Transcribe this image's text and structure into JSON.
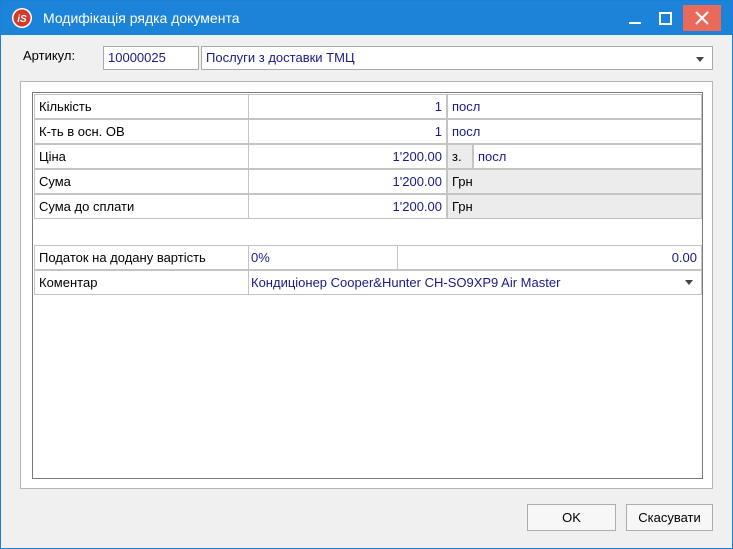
{
  "window": {
    "title": "Модифікація рядка документа",
    "accent": "#1c84d8",
    "close_color": "#e96a5b"
  },
  "header": {
    "article_label": "Артикул:",
    "article_code": "10000025",
    "article_name": "Послуги з доставки ТМЦ"
  },
  "rows": [
    {
      "label": "Кількість",
      "value": "1",
      "unit": "посл"
    },
    {
      "label": "К-ть в осн. ОВ",
      "value": "1",
      "unit": "посл"
    },
    {
      "label": "Ціна",
      "value": "1'200.00",
      "unit_prefix": "з.",
      "unit": "посл"
    },
    {
      "label": "Сума",
      "value": "1'200.00",
      "unit": "Грн"
    },
    {
      "label": "Сума до сплати",
      "value": "1'200.00",
      "unit": "Грн"
    }
  ],
  "vat": {
    "label": "Податок на додану вартість",
    "rate": "0%",
    "amount": "0.00"
  },
  "comment": {
    "label": "Коментар",
    "value": "Кондиціонер Cooper&Hunter CH-SO9XP9 Air Master"
  },
  "buttons": {
    "ok": "OK",
    "cancel": "Скасувати"
  },
  "icons": [
    "app-logo-icon",
    "minimize-icon",
    "maximize-icon",
    "close-icon",
    "chevron-down-icon"
  ]
}
